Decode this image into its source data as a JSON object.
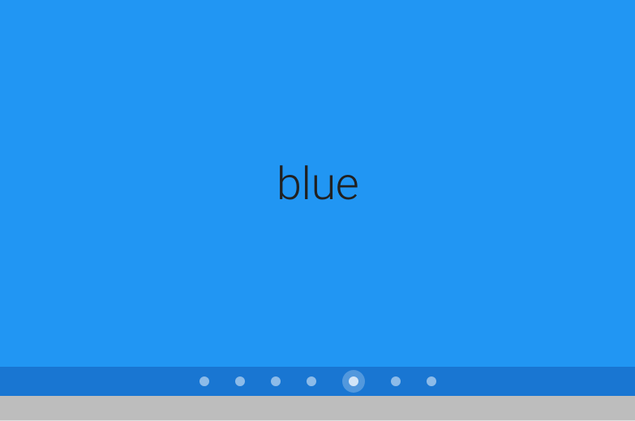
{
  "carousel": {
    "current_slide": {
      "label": "blue",
      "background_color": "#2196F3"
    },
    "indicator_bar_color": "#1976D2",
    "active_index": 4,
    "dot_count": 7
  },
  "footer_strip_color": "#bdbdbd"
}
